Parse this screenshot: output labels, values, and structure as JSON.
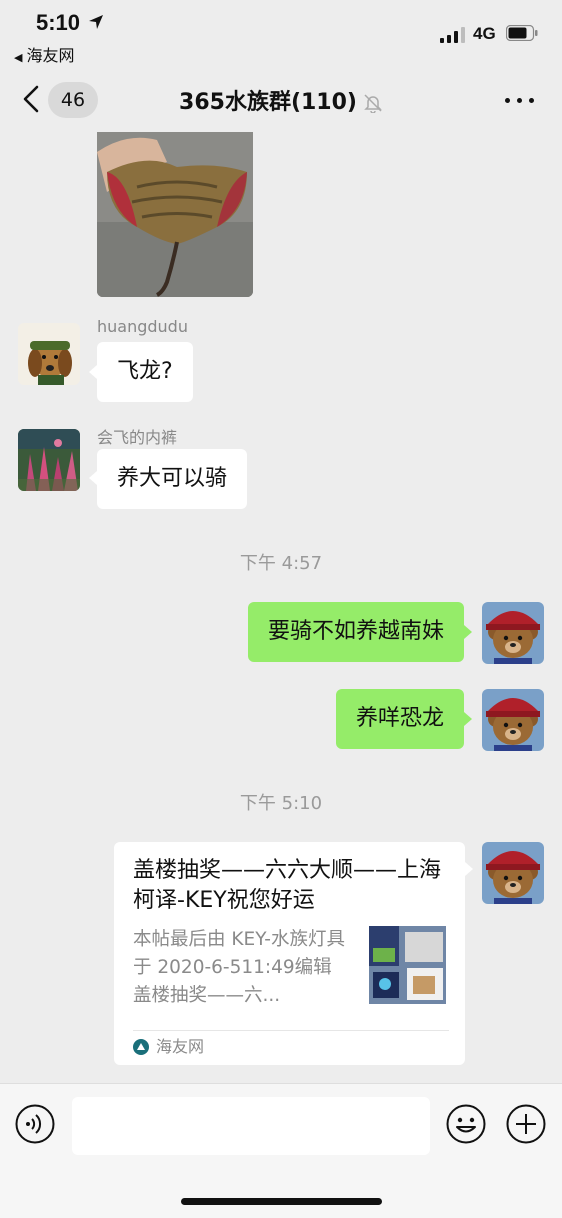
{
  "status_bar": {
    "time": "5:10",
    "back_app": "海友网",
    "network": "4G"
  },
  "nav": {
    "unread_count": "46",
    "title": "365水族群(110)"
  },
  "messages": [
    {
      "type": "image",
      "side": "left"
    },
    {
      "type": "text",
      "side": "left",
      "sender": "huangdudu",
      "text": "飞龙?"
    },
    {
      "type": "text",
      "side": "left",
      "sender": "会飞的内裤",
      "text": "养大可以骑"
    },
    {
      "type": "timestamp",
      "text": "下午 4:57"
    },
    {
      "type": "text",
      "side": "right",
      "text": "要骑不如养越南妹"
    },
    {
      "type": "text",
      "side": "right",
      "text": "养咩恐龙"
    },
    {
      "type": "timestamp",
      "text": "下午 5:10"
    },
    {
      "type": "link_card",
      "side": "right",
      "title": "盖楼抽奖——六六大顺——上海柯译-KEY祝您好运",
      "description": "本帖最后由 KEY-水族灯具于 2020-6-511:49编辑盖楼抽奖——六...",
      "source": "海友网"
    }
  ],
  "input": {
    "value": ""
  },
  "colors": {
    "chat_background": "#ededed",
    "sent_bubble": "#95ec69",
    "received_bubble": "#ffffff",
    "timestamp_text": "#9a9a9a"
  }
}
